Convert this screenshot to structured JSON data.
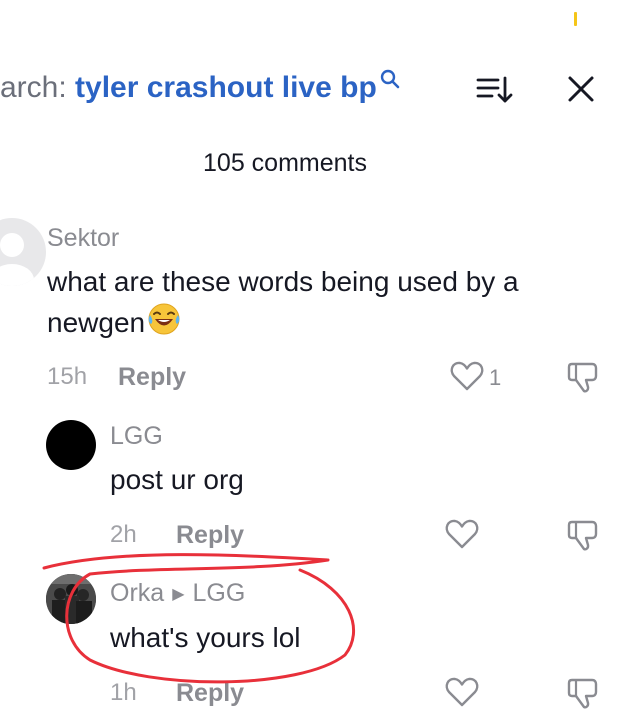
{
  "header": {
    "search_prefix": "arch: ",
    "search_query": "tyler crashout live bp",
    "comments_count": "105 comments"
  },
  "icons": {
    "search": "search-icon",
    "sort": "sort-icon",
    "close": "close-icon",
    "like": "heart-icon",
    "dislike": "thumbs-down-icon"
  },
  "colors": {
    "query_blue": "#2b63c4",
    "annotation_red": "#e8303a"
  },
  "comments": [
    {
      "username": "Sektor",
      "text": "what are these words being used by a newgen",
      "emoji": "😂",
      "time": "15h",
      "reply_label": "Reply",
      "like_count": "1"
    },
    {
      "username": "LGG",
      "text": "post ur org",
      "time": "2h",
      "reply_label": "Reply"
    },
    {
      "username": "Orka",
      "reply_to": "LGG",
      "text": "what's yours lol",
      "time": "1h",
      "reply_label": "Reply"
    }
  ]
}
